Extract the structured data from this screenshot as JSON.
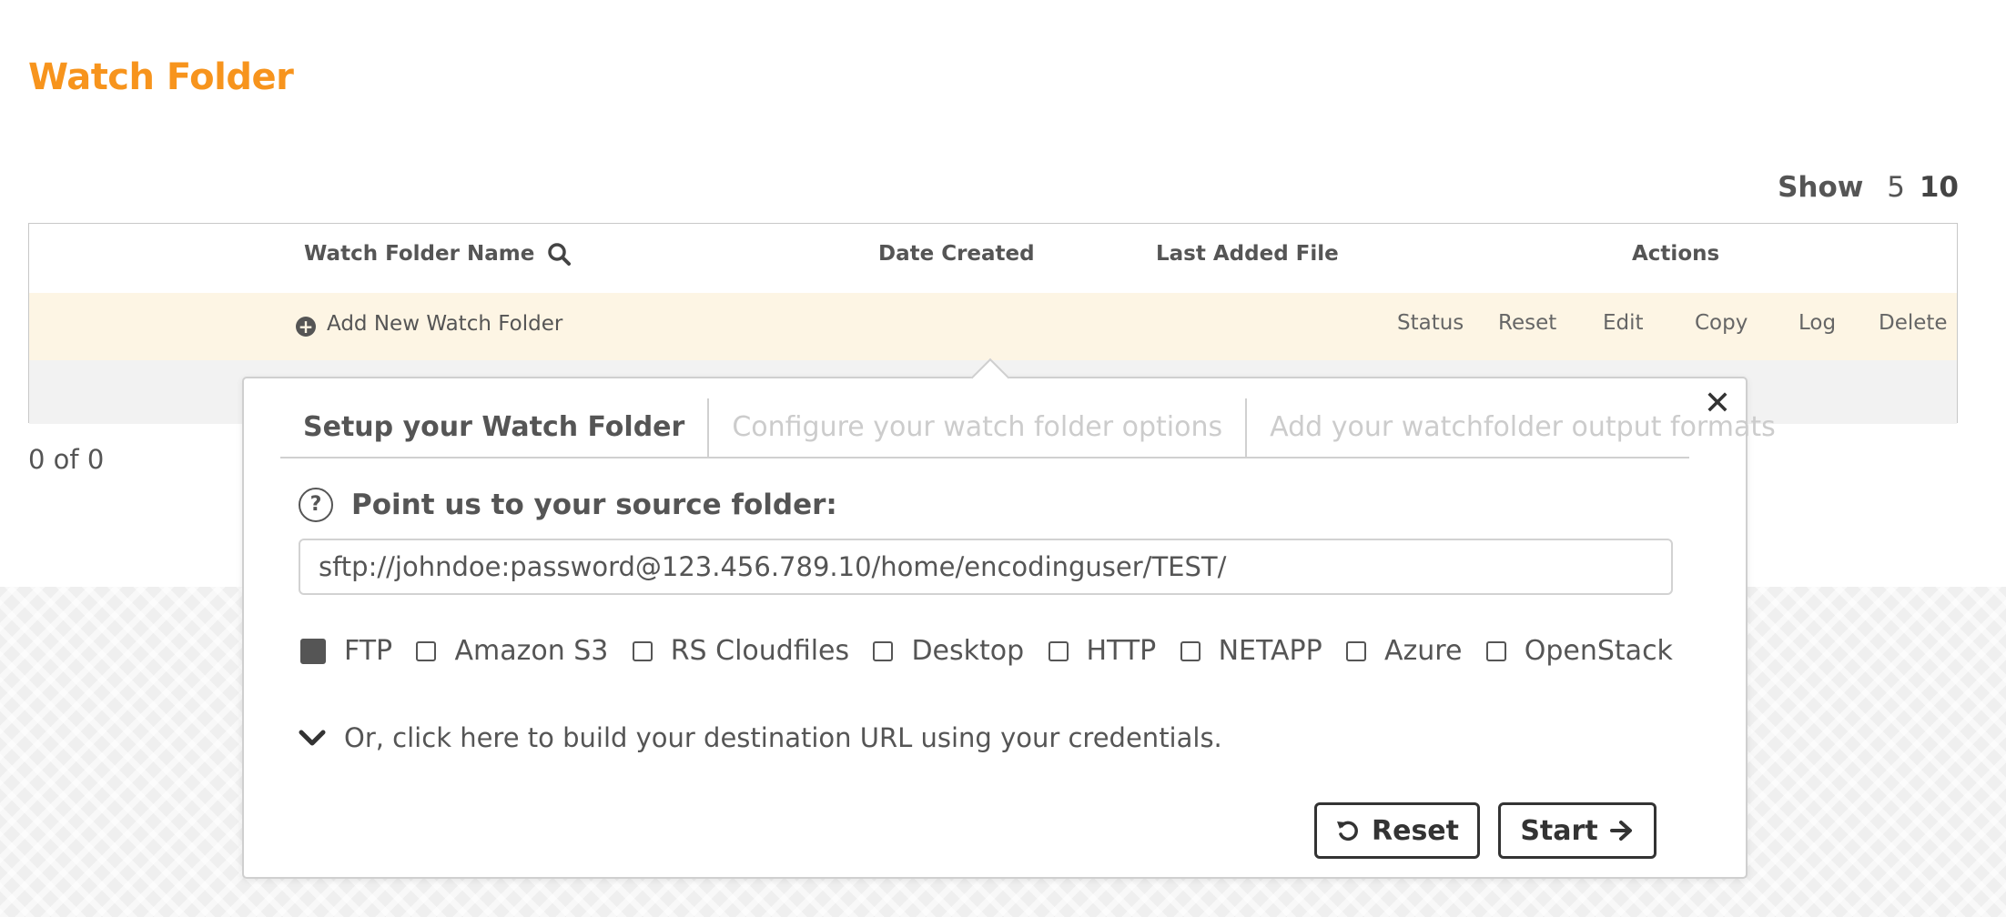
{
  "page": {
    "title": "Watch Folder"
  },
  "show": {
    "label": "Show",
    "options": [
      "5",
      "10"
    ],
    "selected": "10"
  },
  "table": {
    "headers": {
      "name": "Watch Folder Name",
      "date": "Date Created",
      "last": "Last Added File",
      "actions": "Actions"
    },
    "add_new": "Add New Watch Folder",
    "actions": [
      "Status",
      "Reset",
      "Edit",
      "Copy",
      "Log",
      "Delete"
    ],
    "count": "0 of 0"
  },
  "modal": {
    "tabs": [
      "Setup your Watch Folder",
      "Configure your watch folder options",
      "Add your watchfolder output formats"
    ],
    "source_label": "Point us to your source folder:",
    "source_url": "sftp://johndoe:password@123.456.789.10/home/encodinguser/TEST/",
    "options": [
      {
        "label": "FTP",
        "checked": true
      },
      {
        "label": "Amazon S3",
        "checked": false
      },
      {
        "label": "RS Cloudfiles",
        "checked": false
      },
      {
        "label": "Desktop",
        "checked": false
      },
      {
        "label": "HTTP",
        "checked": false
      },
      {
        "label": "NETAPP",
        "checked": false
      },
      {
        "label": "Azure",
        "checked": false
      },
      {
        "label": "OpenStack",
        "checked": false
      }
    ],
    "build_link": "Or, click here to build your destination URL using your credentials.",
    "reset_label": "Reset",
    "start_label": "Start"
  },
  "colors": {
    "accent": "#f7941d",
    "row_highlight": "#fdf5e4",
    "text": "#555555"
  }
}
